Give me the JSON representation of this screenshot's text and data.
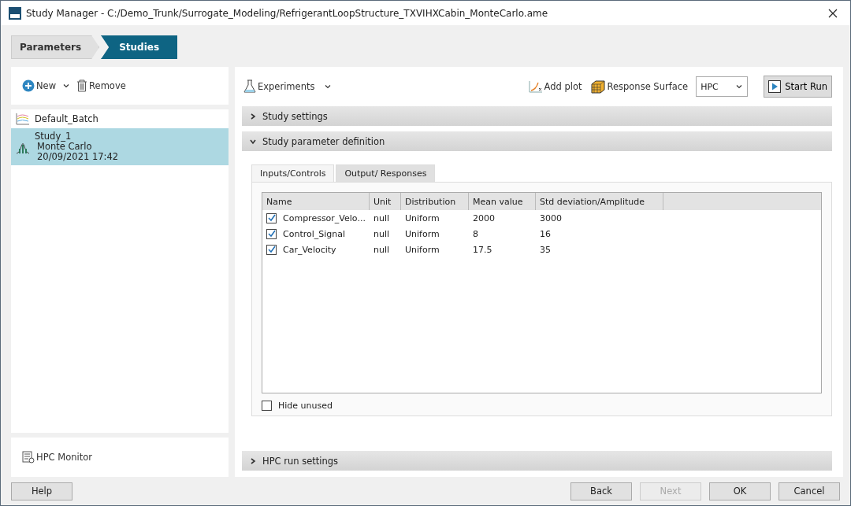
{
  "window": {
    "title": "Study Manager - C:/Demo_Trunk/Surrogate_Modeling/RefrigerantLoopStructure_TXVIHXCabin_MonteCarlo.ame"
  },
  "breadcrumb": [
    {
      "label": "Parameters",
      "selected": false
    },
    {
      "label": "Studies",
      "selected": true
    }
  ],
  "left_toolbar": {
    "new": "New",
    "remove": "Remove"
  },
  "studies": [
    {
      "kind": "batch",
      "lines": [
        "Default_Batch"
      ],
      "selected": false
    },
    {
      "kind": "montecarlo",
      "lines": [
        "Study_1",
        "Monte Carlo",
        "20/09/2021 17:42"
      ],
      "selected": true
    }
  ],
  "hpc_monitor": "HPC Monitor",
  "right_toolbar": {
    "experiments": "Experiments",
    "add_plot": "Add plot",
    "response_surface": "Response Surface",
    "target": "HPC",
    "start_run": "Start Run"
  },
  "sections": [
    {
      "title": "Study settings",
      "expanded": false
    },
    {
      "title": "Study parameter definition",
      "expanded": true
    }
  ],
  "tabs": [
    {
      "label": "Inputs/Controls",
      "selected": true
    },
    {
      "label": "Output/ Responses",
      "selected": false
    }
  ],
  "table": {
    "columns": [
      "Name",
      "Unit",
      "Distribution",
      "Mean value",
      "Std deviation/Amplitude"
    ],
    "rows": [
      {
        "checked": true,
        "cells": [
          "Compressor_Velo...",
          "null",
          "Uniform",
          "2000",
          "3000"
        ]
      },
      {
        "checked": true,
        "cells": [
          "Control_Signal",
          "null",
          "Uniform",
          "8",
          "16"
        ]
      },
      {
        "checked": true,
        "cells": [
          "Car_Velocity",
          "null",
          "Uniform",
          "17.5",
          "35"
        ]
      }
    ]
  },
  "hide_unused": {
    "label": "Hide unused",
    "checked": false
  },
  "hpc_section": {
    "title": "HPC run settings",
    "expanded": false
  },
  "footer": {
    "help": "Help",
    "buttons": [
      {
        "label": "Back",
        "disabled": false
      },
      {
        "label": "Next",
        "disabled": true
      },
      {
        "label": "OK",
        "disabled": false
      },
      {
        "label": "Cancel",
        "disabled": false
      }
    ]
  }
}
